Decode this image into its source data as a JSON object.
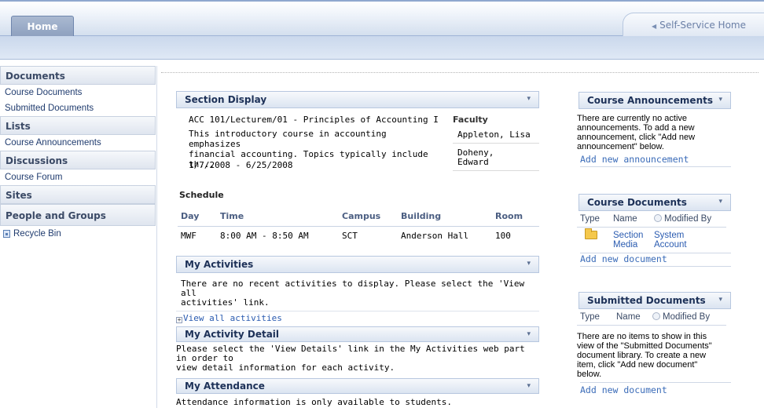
{
  "header": {
    "home_tab": "Home",
    "self_service": "Self-Service Home"
  },
  "nav": {
    "documents": "Documents",
    "course_documents": "Course Documents",
    "submitted_documents": "Submitted Documents",
    "lists": "Lists",
    "course_announcements": "Course Announcements",
    "discussions": "Discussions",
    "course_forum": "Course Forum",
    "sites": "Sites",
    "people_groups": "People and Groups",
    "recycle_bin": "Recycle Bin"
  },
  "section_display": {
    "title": "Section Display",
    "course": "ACC 101/Lecturem/01 - Principles of Accounting I",
    "description_line1": "This introductory course in accounting emphasizes",
    "description_line2": "financial accounting. Topics typically include th...",
    "dates": "1/7/2008 - 6/25/2008",
    "faculty_label": "Faculty",
    "faculty": [
      "Appleton, Lisa",
      "Doheny,",
      "Edward"
    ]
  },
  "schedule": {
    "label": "Schedule",
    "columns": [
      "Day",
      "Time",
      "Campus",
      "Building",
      "Room"
    ],
    "rows": [
      [
        "MWF",
        "8:00 AM - 8:50 AM",
        "SCT",
        "Anderson Hall",
        "100"
      ]
    ]
  },
  "my_activities": {
    "title": "My Activities",
    "text_line1": "There are no recent activities to display. Please select the 'View all",
    "text_line2": "activities' link.",
    "view_all": "View all activities"
  },
  "my_activity_detail": {
    "title": "My Activity Detail",
    "text_line1": "Please select the 'View Details' link in the My Activities web part in order to",
    "text_line2": "view detail information for each activity."
  },
  "my_attendance": {
    "title": "My Attendance",
    "text": "Attendance information is only available to students."
  },
  "course_announcements": {
    "title": "Course Announcements",
    "text_line1": "There are currently no active",
    "text_line2": "announcements. To add a new",
    "text_line3": "announcement, click \"Add new",
    "text_line4": "announcement\" below.",
    "add_link": "Add new announcement"
  },
  "course_documents": {
    "title": "Course Documents",
    "col_type": "Type",
    "col_name": "Name",
    "col_modified": "Modified By",
    "item_name_line1": "Section",
    "item_name_line2": "Media",
    "item_modified_line1": "System",
    "item_modified_line2": "Account",
    "add_link": "Add new document"
  },
  "submitted_documents": {
    "title": "Submitted Documents",
    "col_type": "Type",
    "col_name": "Name",
    "col_modified": "Modified By",
    "text_line1": "There are no items to show in this",
    "text_line2": "view of the \"Submitted Documents\"",
    "text_line3": "document library. To create a new",
    "text_line4": "item, click \"Add new document\"",
    "text_line5": "below.",
    "add_link": "Add new document"
  },
  "menu_glyph": "▾"
}
